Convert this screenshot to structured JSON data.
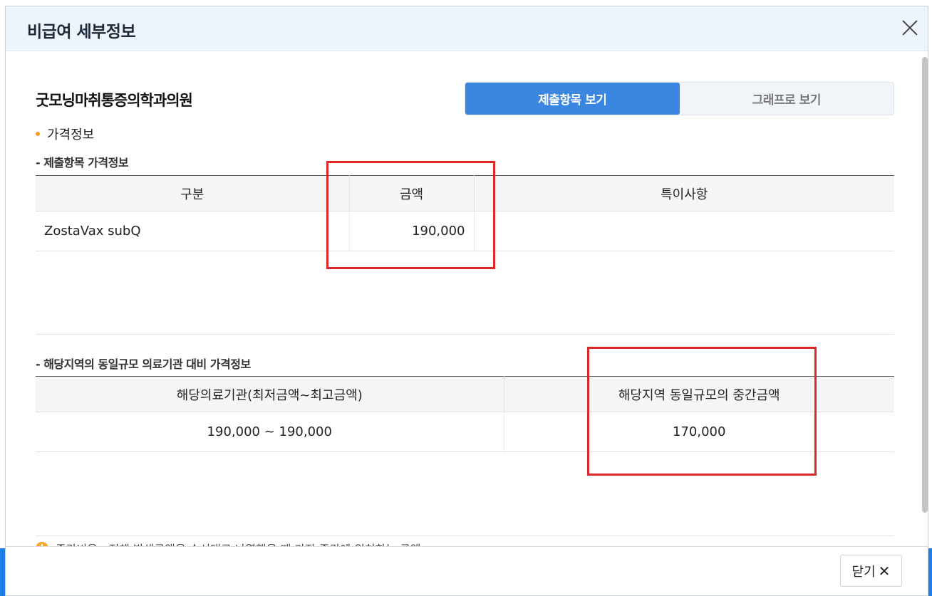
{
  "modal": {
    "title": "비급여 세부정보",
    "close_label": "닫기",
    "close_icon": "✕"
  },
  "hospital": {
    "name": "굿모닝마취통증의학과의원"
  },
  "view_toggle": {
    "options": [
      "제출항목 보기",
      "그래프로 보기"
    ],
    "selected": "제출항목 보기"
  },
  "section": {
    "title": "가격정보"
  },
  "submitted_price": {
    "title": "- 제출항목 가격정보",
    "headers": [
      "구분",
      "금액",
      "특이사항"
    ],
    "rows": [
      [
        "ZostaVax subQ",
        "190,000",
        ""
      ]
    ]
  },
  "regional_price": {
    "title": "- 해당지역의 동일규모 의료기관 대비 가격정보",
    "headers": [
      "해당의료기관(최저금액~최고금액)",
      "해당지역 동일규모의 중간금액"
    ],
    "rows": [
      [
        "190,000 ~ 190,000",
        "170,000"
      ]
    ]
  },
  "note": {
    "icon": "!",
    "text": "중간비용 : 전체 발생금액을 순서대로 나열했을 때 가장 중간에 위치하는 금액"
  },
  "colors": {
    "accent": "#3a86e0",
    "highlight_box": "#e02727",
    "bullet": "#f59a23"
  }
}
